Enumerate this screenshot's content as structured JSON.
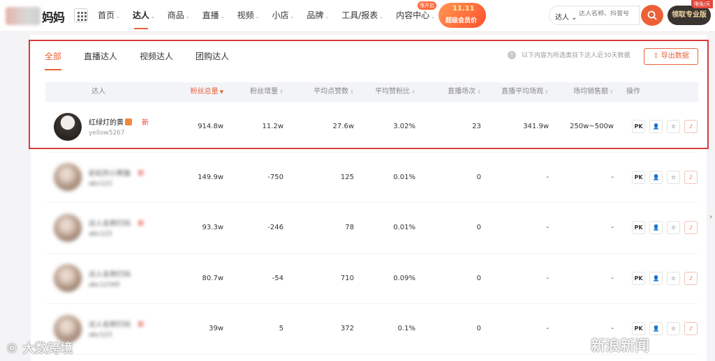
{
  "header": {
    "logo_text": "妈妈",
    "nav": [
      {
        "label": "首页",
        "caret": "⌄",
        "active": false
      },
      {
        "label": "达人",
        "caret": "⌄",
        "active": true
      },
      {
        "label": "商品",
        "caret": "⌄",
        "active": false
      },
      {
        "label": "直播",
        "caret": "⌄",
        "active": false
      },
      {
        "label": "视频",
        "caret": "⌄",
        "active": false
      },
      {
        "label": "小店",
        "caret": "⌄",
        "active": false
      },
      {
        "label": "品牌",
        "caret": "⌄",
        "active": false
      },
      {
        "label": "工具/报表",
        "caret": "⌄",
        "active": false
      },
      {
        "label": "内容中心",
        "caret": "⌄",
        "active": false
      }
    ],
    "content_badge": "限开启",
    "promo_line1": "11.11",
    "promo_line2": "超级会员价",
    "search_type": "达人 ⌄",
    "search_placeholder": "达人名称、抖音号",
    "pro_button": "领取专业版",
    "corner_badge": "限免/天"
  },
  "tabs": [
    {
      "label": "全部",
      "active": true
    },
    {
      "label": "直播达人",
      "active": false
    },
    {
      "label": "视频达人",
      "active": false
    },
    {
      "label": "团购达人",
      "active": false
    }
  ],
  "hint": "以下内容为所选类目下达人近30天数据",
  "export_label": "导出数据",
  "columns": {
    "name": "达人",
    "fans": "粉丝总量",
    "fans_inc": "粉丝增量",
    "avg_likes": "平均点赞数",
    "like_ratio": "平均赞粉比",
    "live_count": "直播场次",
    "live_avg_view": "直播平均场观",
    "sales": "场均销售额",
    "ops": "操作"
  },
  "rows": [
    {
      "name": "红绿灯的黄",
      "uid": "yellow5267",
      "tag": "新",
      "fans": "914.8w",
      "fans_inc": "11.2w",
      "avg_likes": "27.6w",
      "like_ratio": "3.02%",
      "live_count": "23",
      "live_avg_view": "341.9w",
      "sales": "250w~500w",
      "blurred": false
    },
    {
      "name": "彩虹的小熊猫",
      "uid": "abc123",
      "tag": "新",
      "fans": "149.9w",
      "fans_inc": "-750",
      "avg_likes": "125",
      "like_ratio": "0.01%",
      "live_count": "0",
      "live_avg_view": "-",
      "sales": "-",
      "blurred": true
    },
    {
      "name": "达人名称打码",
      "uid": "abc123",
      "tag": "新",
      "fans": "93.3w",
      "fans_inc": "-246",
      "avg_likes": "78",
      "like_ratio": "0.01%",
      "live_count": "0",
      "live_avg_view": "-",
      "sales": "-",
      "blurred": true
    },
    {
      "name": "达人名称打码",
      "uid": "abc12345",
      "tag": "",
      "fans": "80.7w",
      "fans_inc": "-54",
      "avg_likes": "710",
      "like_ratio": "0.09%",
      "live_count": "0",
      "live_avg_view": "-",
      "sales": "-",
      "blurred": true
    },
    {
      "name": "达人名称打码",
      "uid": "abc123",
      "tag": "新",
      "fans": "39w",
      "fans_inc": "5",
      "avg_likes": "372",
      "like_ratio": "0.1%",
      "live_count": "0",
      "live_avg_view": "-",
      "sales": "-",
      "blurred": true
    }
  ],
  "op_pk": "PK",
  "watermark_left": "© 大数跨境",
  "watermark_right": "新浪新闻"
}
